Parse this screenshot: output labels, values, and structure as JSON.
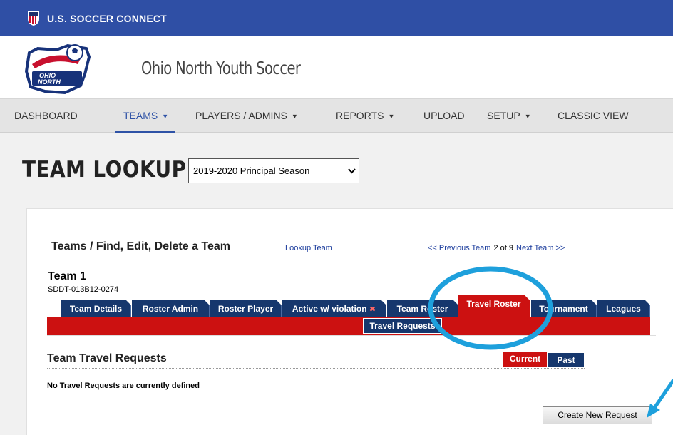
{
  "topbar": {
    "title": "U.S. SOCCER CONNECT",
    "logo_icon": "usa-soccer-shield-icon"
  },
  "brand": {
    "org_name": "Ohio North Youth Soccer",
    "logo_text": "OHIO NORTH"
  },
  "nav": {
    "items": [
      {
        "label": "DASHBOARD",
        "dropdown": false
      },
      {
        "label": "TEAMS",
        "dropdown": true,
        "active": true
      },
      {
        "label": "PLAYERS / ADMINS",
        "dropdown": true
      },
      {
        "label": "REPORTS",
        "dropdown": true
      },
      {
        "label": "UPLOAD",
        "dropdown": false
      },
      {
        "label": "SETUP",
        "dropdown": true
      },
      {
        "label": "CLASSIC VIEW",
        "dropdown": false
      }
    ]
  },
  "page": {
    "title": "TEAM LOOKUP",
    "season_select": {
      "value": "2019-2020 Principal Season"
    }
  },
  "team_panel": {
    "breadcrumb": "Teams / Find, Edit, Delete a Team",
    "lookup_link": "Lookup Team",
    "pager": {
      "prev": "<< Previous Team",
      "count": "2 of 9",
      "next": "Next Team >>"
    },
    "team_name": "Team 1",
    "team_code": "SDDT-013B12-0274",
    "tabs": [
      "Team Details",
      "Roster Admin",
      "Roster Player",
      "Active w/ violation",
      "Team Roster",
      "Travel Roster",
      "Tournament",
      "Leagues"
    ],
    "active_tab": "Travel Roster",
    "subtab": "Travel Requests"
  },
  "travel": {
    "section_title": "Team Travel Requests",
    "toggle_current": "Current",
    "toggle_past": "Past",
    "empty_message": "No Travel Requests are currently defined",
    "create_button": "Create New Request"
  },
  "colors": {
    "brand_blue": "#2f4fa5",
    "tab_navy": "#16376d",
    "tab_red": "#cc1111",
    "annotation_blue": "#1ea0dc"
  }
}
